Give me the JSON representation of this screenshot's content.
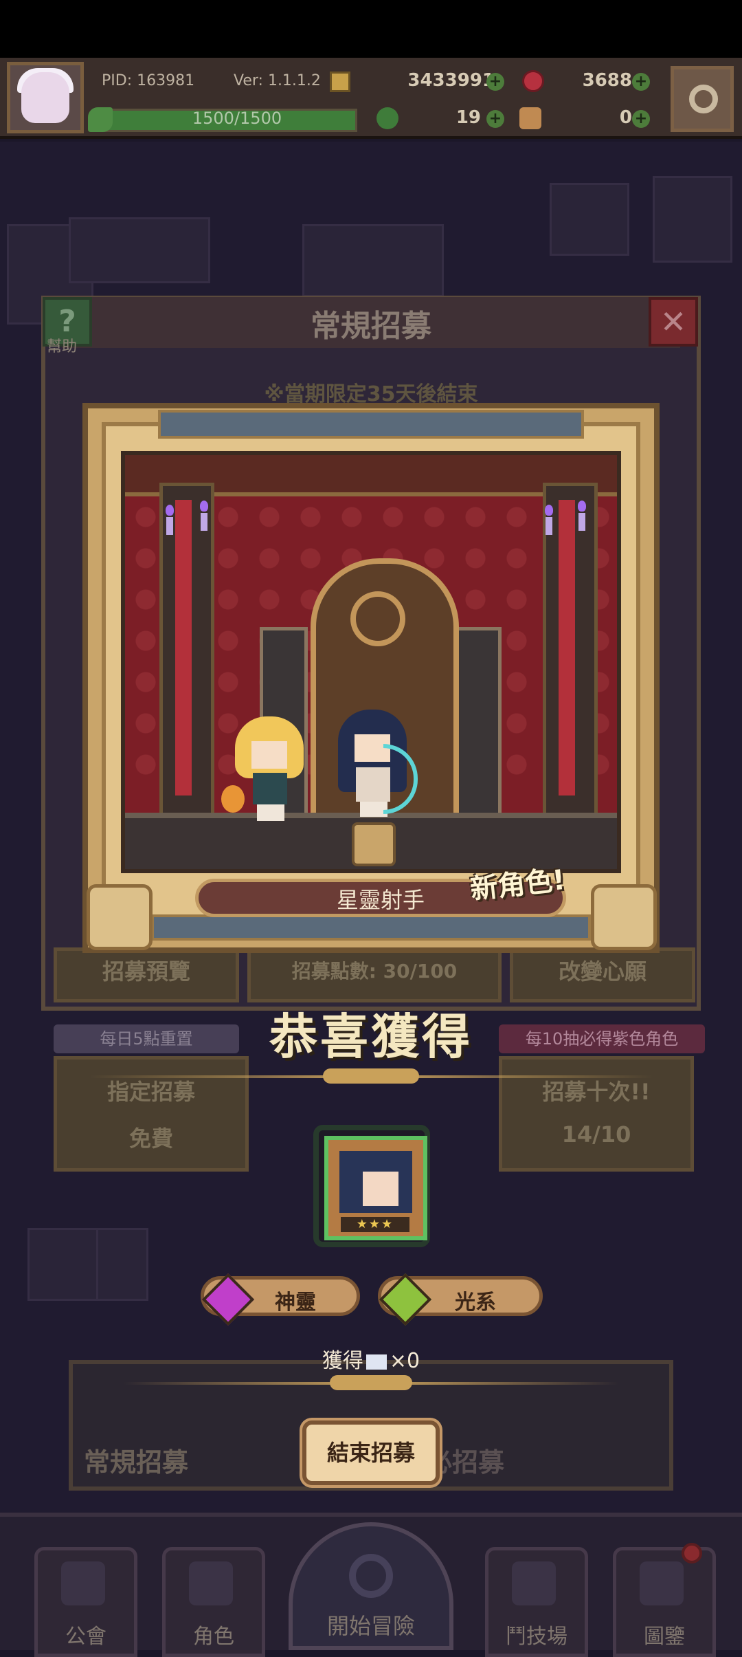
{
  "hud": {
    "pid": "PID: 163981",
    "version": "Ver: 1.1.1.2",
    "gold": "3433991",
    "gems": "3688",
    "stamina": "1500/1500",
    "stamina_fraction": 1.0,
    "clover": "19",
    "hands": "0",
    "plus": "+",
    "icons": [
      "avatar",
      "coin-icon",
      "gem-icon",
      "leaf-icon",
      "clover-icon",
      "hand-icon",
      "gear-icon"
    ]
  },
  "panel": {
    "title": "常規招募",
    "help_label": "幫助",
    "limited_notice": "※當期限定35天後結束",
    "close_symbol": "✕",
    "help_symbol": "?",
    "daily_reset": "每日5點重置",
    "guarantee": "每10抽必得紫色角色",
    "buttons": {
      "preview": "招募預覽",
      "points": "招募點數: 30/100",
      "wish": "改變心願",
      "designated": "指定招募",
      "designated_cost": "免費",
      "ten": "招募十次!!",
      "ten_cost": "14/10"
    }
  },
  "reveal": {
    "character_name": "星靈射手",
    "new_label": "新角色!",
    "congrats": "恭喜獲得",
    "stars": "★★★",
    "tags": [
      {
        "label": "神靈",
        "color": "#c03fca",
        "icon": "purple-gem-icon"
      },
      {
        "label": "光系",
        "color": "#8ec23e",
        "icon": "green-gem-icon"
      }
    ],
    "obtain_prefix": "獲得",
    "obtain_suffix": "×0",
    "end_button": "結束招募"
  },
  "banner": {
    "left": "常規招募",
    "right": "必招募"
  },
  "nav": [
    {
      "label": "公會",
      "icon": "guild-icon"
    },
    {
      "label": "角色",
      "icon": "character-icon"
    },
    {
      "label": "開始冒險",
      "icon": "magnifier-icon"
    },
    {
      "label": "鬥技場",
      "icon": "swords-icon"
    },
    {
      "label": "圖鑒",
      "icon": "book-icon"
    }
  ]
}
